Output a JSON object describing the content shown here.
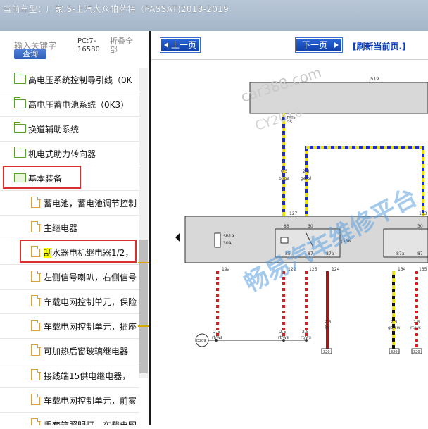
{
  "title": {
    "label": "当前车型：",
    "vehicle": "厂家:S-上汽大众帕萨特（PASSAT)2018-2019"
  },
  "search": {
    "placeholder": "输入关键字",
    "query_button": "查询",
    "pc_line1": "PC:7-",
    "pc_line2": "16580",
    "fold_line1": "折叠全",
    "fold_line2": "部"
  },
  "tree": {
    "folders": [
      {
        "label": "高电压系统控制导引线（0K"
      },
      {
        "label": "高电压蓄电池系统（0K3）"
      },
      {
        "label": "换道辅助系统"
      },
      {
        "label": "机电式助力转向器"
      }
    ],
    "open_folder": {
      "label": "基本装备"
    },
    "docs": [
      {
        "label": "蓄电池，蓄电池调节控制"
      },
      {
        "label": "主继电器"
      },
      {
        "mark": "刮",
        "label": "水器电机继电器1/2，"
      },
      {
        "label": "左侧信号喇叭，右侧信号"
      },
      {
        "label": "车载电网控制单元，保险"
      },
      {
        "label": "车载电网控制单元，插座"
      },
      {
        "label": "可加热后窗玻璃继电器"
      },
      {
        "label": "接线端15供电继电器，"
      },
      {
        "label": "车载电网控制单元，前雾"
      },
      {
        "label": "手套箱照明灯，车载电网"
      }
    ]
  },
  "toolbar": {
    "prev": "上一页",
    "next": "下一页",
    "refresh": "[刷新当前页.]"
  },
  "diagram": {
    "watermark1": "car388.com",
    "watermark2": "CY2016",
    "watermark_cn": "畅易汽车维修平台",
    "j519": "J519",
    "t46b": "T46b",
    "t46b_pin": "/25",
    "wire1_size": "0.5",
    "wire1_color": "bl/ge",
    "wire2_size": "2.5",
    "wire2_color": "ge/bl",
    "pin_127": "127",
    "pin_133": "133",
    "pin_30a": "30",
    "pin_30b": "30",
    "sb19": "SB19",
    "sb19_rating": "30A",
    "j388": "J388",
    "pin_86": "86",
    "pin_85": "85",
    "pin_87": "87",
    "pin_87a": "87a",
    "pin_87b": "87",
    "pin_87a2": "87a",
    "conn_19a": "19a",
    "conn_122": "122",
    "conn_125": "125",
    "conn_124": "124",
    "conn_134": "134",
    "conn_135": "135",
    "w_a_size": "2.5",
    "w_a_color": "rt/ws",
    "w_b_size": "2.5",
    "w_b_color": "rt/ws",
    "w_c_size": "2.5",
    "w_c_color": "rt/ws",
    "w_d_size": "2.5",
    "w_d_color": "br",
    "w_e_size": "2.5",
    "w_e_color": "ge/sw",
    "w_f_size": "2.5",
    "w_f_color": "rt/ws",
    "ground": "D209",
    "t_329a": "329",
    "t_329b": "329",
    "t_329c": "329"
  }
}
